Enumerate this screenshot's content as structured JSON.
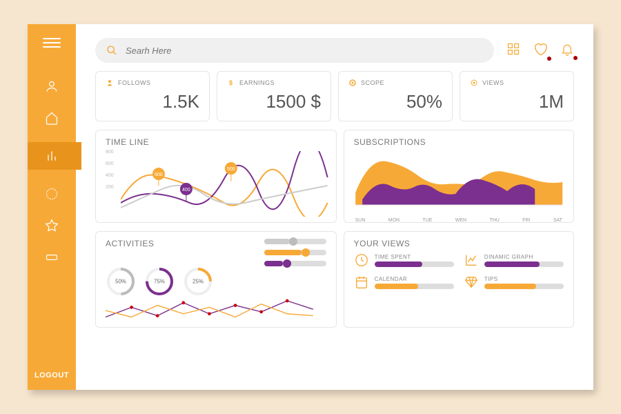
{
  "colors": {
    "accent": "#f7a937",
    "purple": "#7b2f8e",
    "gray": "#ddd"
  },
  "sidebar": {
    "logout": "LOGOUT"
  },
  "search": {
    "placeholder": "Searh Here"
  },
  "stats": [
    {
      "icon": "user",
      "label": "FOLLOWS",
      "value": "1.5K"
    },
    {
      "icon": "dollar",
      "label": "EARNINGS",
      "value": "1500 $"
    },
    {
      "icon": "target",
      "label": "SCOPE",
      "value": "50%"
    },
    {
      "icon": "radio",
      "label": "VIEWS",
      "value": "1M"
    }
  ],
  "timeline": {
    "title": "TIME LINE"
  },
  "subscriptions": {
    "title": "SUBSCRIPTIONS"
  },
  "activities": {
    "title": "ACTIVITIES",
    "gauges": [
      {
        "pct": 50,
        "label": "50%"
      },
      {
        "pct": 75,
        "label": "75%"
      },
      {
        "pct": 25,
        "label": "25%"
      }
    ],
    "bars": [
      {
        "fill": 40,
        "color": "#ccc"
      },
      {
        "fill": 60,
        "color": "#f7a937"
      },
      {
        "fill": 30,
        "color": "#7b2f8e"
      }
    ]
  },
  "views": {
    "title": "YOUR VIEWS",
    "items": [
      {
        "label": "TIME SPENT",
        "fill": 60,
        "color": "#7b2f8e"
      },
      {
        "label": "DINAMIC GRAPH",
        "fill": 70,
        "color": "#7b2f8e"
      },
      {
        "label": "CALENDAR",
        "fill": 55,
        "color": "#f7a937"
      },
      {
        "label": "TIPS",
        "fill": 65,
        "color": "#f7a937"
      }
    ]
  },
  "chart_data": [
    {
      "type": "line",
      "title": "TIME LINE",
      "ylim": [
        200,
        800
      ],
      "yticks": [
        800,
        600,
        400,
        200
      ],
      "series": [
        {
          "name": "orange",
          "values": [
            350,
            600,
            500,
            300,
            550,
            400,
            300
          ],
          "annotations": [
            {
              "i": 1,
              "v": 600
            },
            {
              "i": 4,
              "v": 500
            }
          ]
        },
        {
          "name": "purple",
          "values": [
            300,
            400,
            320,
            500,
            400,
            600,
            550
          ],
          "annotations": [
            {
              "i": 2,
              "v": 400
            }
          ]
        },
        {
          "name": "gray",
          "values": [
            250,
            350,
            450,
            380,
            300,
            380,
            450
          ]
        }
      ]
    },
    {
      "type": "area",
      "title": "SUBSCRIPTIONS",
      "categories": [
        "SUN",
        "MON",
        "TUE",
        "WEN",
        "THU",
        "FRI",
        "SAT"
      ],
      "series": [
        {
          "name": "orange",
          "values": [
            50,
            85,
            75,
            60,
            55,
            70,
            65
          ]
        },
        {
          "name": "purple",
          "values": [
            20,
            60,
            35,
            45,
            30,
            55,
            35
          ]
        }
      ]
    },
    {
      "type": "line",
      "title": "ACTIVITIES",
      "series": [
        {
          "name": "purple",
          "values": [
            20,
            40,
            25,
            50,
            30,
            45,
            35,
            55
          ]
        },
        {
          "name": "orange",
          "values": [
            35,
            25,
            45,
            30,
            40,
            25,
            50,
            30
          ]
        }
      ]
    }
  ]
}
